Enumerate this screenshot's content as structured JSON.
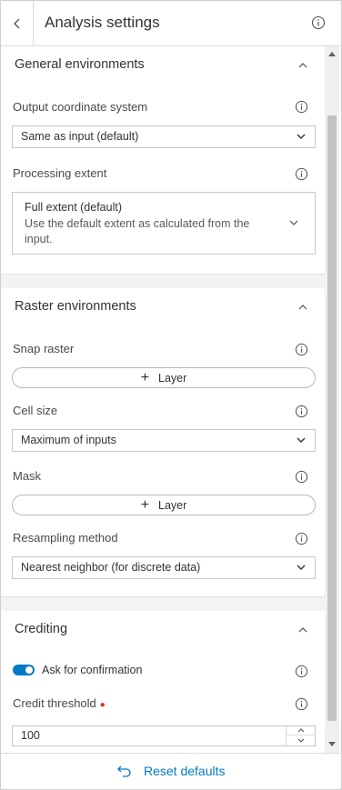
{
  "header": {
    "title": "Analysis settings",
    "back_icon": "chevron-left-icon",
    "info_icon": "info-icon"
  },
  "sections": {
    "general": {
      "title": "General environments",
      "output_coord": {
        "label": "Output coordinate system",
        "value": "Same as input (default)"
      },
      "processing_extent": {
        "label": "Processing extent",
        "value_title": "Full extent (default)",
        "value_desc": "Use the default extent as calculated from the input."
      }
    },
    "raster": {
      "title": "Raster environments",
      "snap_raster": {
        "label": "Snap raster",
        "button": "Layer"
      },
      "cell_size": {
        "label": "Cell size",
        "value": "Maximum of inputs"
      },
      "mask": {
        "label": "Mask",
        "button": "Layer"
      },
      "resampling": {
        "label": "Resampling method",
        "value": "Nearest neighbor (for discrete data)"
      }
    },
    "crediting": {
      "title": "Crediting",
      "ask_confirmation": {
        "label": "Ask for confirmation",
        "enabled": true
      },
      "credit_threshold": {
        "label": "Credit threshold",
        "value": "100",
        "required": true
      }
    }
  },
  "footer": {
    "reset_label": "Reset defaults"
  },
  "colors": {
    "accent": "#007ac2",
    "required": "#d83020"
  }
}
